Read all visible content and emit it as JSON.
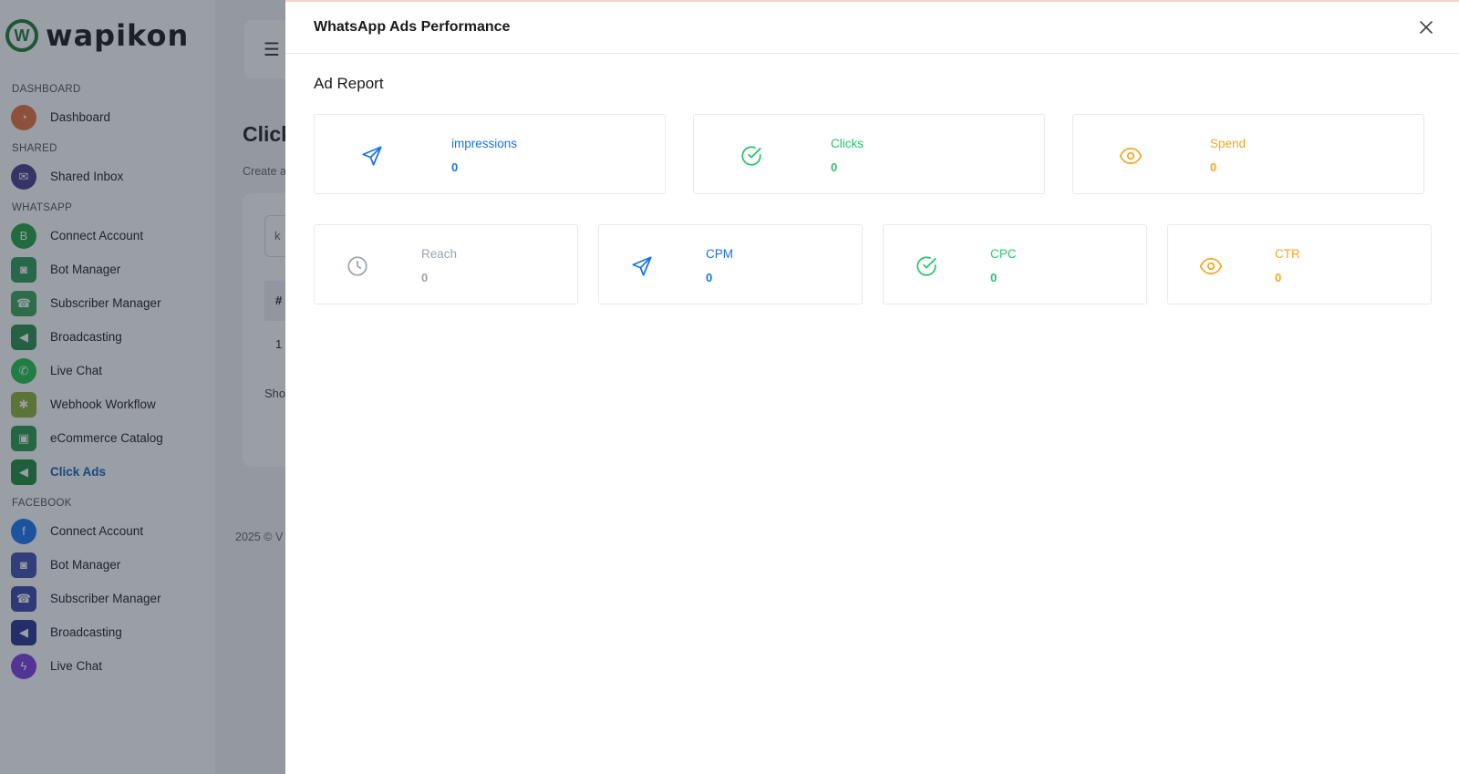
{
  "brand": {
    "name": "wapikon"
  },
  "sidebar": {
    "sections": [
      {
        "label": "DASHBOARD",
        "items": [
          {
            "label": "Dashboard",
            "icon": "dashboard-icon"
          }
        ]
      },
      {
        "label": "SHARED",
        "items": [
          {
            "label": "Shared Inbox",
            "icon": "inbox-icon"
          }
        ]
      },
      {
        "label": "WHATSAPP",
        "items": [
          {
            "label": "Connect Account",
            "icon": "whatsapp-business-icon"
          },
          {
            "label": "Bot Manager",
            "icon": "robot-icon"
          },
          {
            "label": "Subscriber Manager",
            "icon": "subscriber-icon"
          },
          {
            "label": "Broadcasting",
            "icon": "broadcast-icon"
          },
          {
            "label": "Live Chat",
            "icon": "whatsapp-icon"
          },
          {
            "label": "Webhook Workflow",
            "icon": "webhook-icon"
          },
          {
            "label": "eCommerce Catalog",
            "icon": "shopping-bag-icon"
          },
          {
            "label": "Click Ads",
            "icon": "megaphone-icon",
            "active": true
          }
        ]
      },
      {
        "label": "FACEBOOK",
        "items": [
          {
            "label": "Connect Account",
            "icon": "facebook-icon"
          },
          {
            "label": "Bot Manager",
            "icon": "robot-icon"
          },
          {
            "label": "Subscriber Manager",
            "icon": "subscriber-icon"
          },
          {
            "label": "Broadcasting",
            "icon": "broadcast-icon"
          },
          {
            "label": "Live Chat",
            "icon": "messenger-icon"
          }
        ]
      }
    ]
  },
  "background": {
    "title": "Click",
    "subtitle": "Create a",
    "input_fragment": "k",
    "table_head_fragment": "#",
    "row_fragment": "1",
    "show_fragment": "Sho",
    "footer_fragment": "2025 © V"
  },
  "modal": {
    "title": "WhatsApp Ads Performance",
    "report_title": "Ad Report",
    "metrics": [
      {
        "label": "impressions",
        "value": "0",
        "icon": "send-icon",
        "color": "#1a73e8"
      },
      {
        "label": "Clicks",
        "value": "0",
        "icon": "check-circle-icon",
        "color": "#27c46b"
      },
      {
        "label": "Spend",
        "value": "0",
        "icon": "eye-icon",
        "color": "#f5a623"
      },
      {
        "label": "Reach",
        "value": "0",
        "icon": "clock-icon",
        "color": "#9aa3ad"
      },
      {
        "label": "CPM",
        "value": "0",
        "icon": "send-icon",
        "color": "#1a73e8"
      },
      {
        "label": "CPC",
        "value": "0",
        "icon": "check-circle-icon",
        "color": "#27c46b"
      },
      {
        "label": "CTR",
        "value": "0",
        "icon": "eye-icon",
        "color": "#f5a623"
      }
    ]
  }
}
